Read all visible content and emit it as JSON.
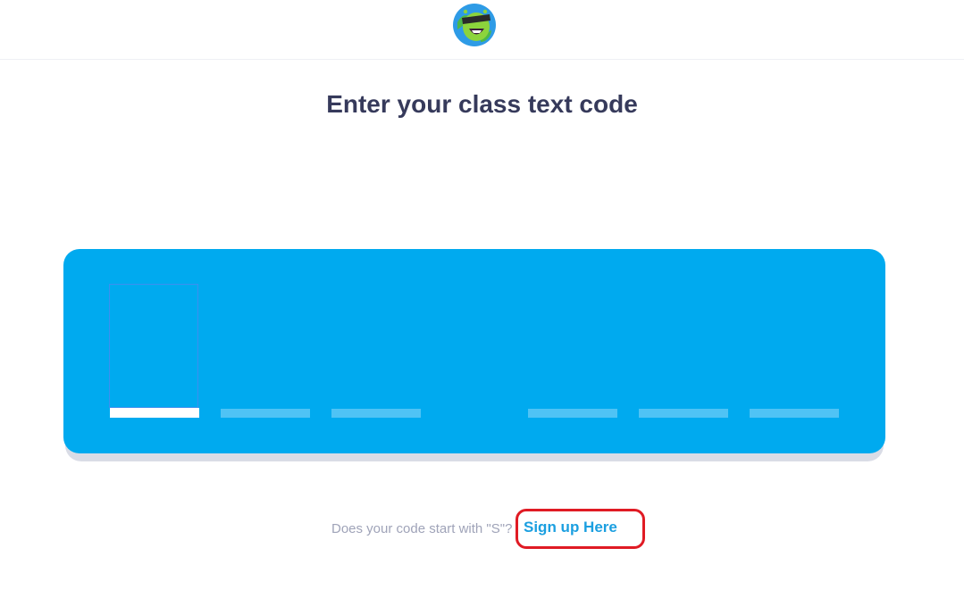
{
  "header": {
    "logo_icon": "classdojo-monster-logo-icon"
  },
  "main": {
    "title": "Enter your class text code",
    "code_slots_total": 6,
    "active_slot_index": 0
  },
  "footer": {
    "prompt": "Does your code start with \"S\"?",
    "signup_label": "Sign up Here"
  },
  "colors": {
    "accent": "#00aaef",
    "title": "#363a5b",
    "link": "#1b9fe0",
    "annotation": "#e01b24"
  }
}
